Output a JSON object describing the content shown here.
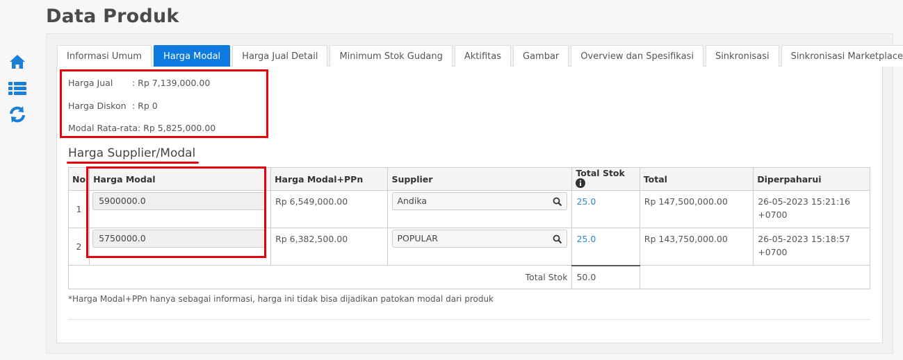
{
  "page": {
    "title": "Data Produk"
  },
  "sidebar": {
    "icons": [
      "home-icon",
      "list-icon",
      "refresh-icon"
    ]
  },
  "tabs": [
    {
      "label": "Informasi Umum"
    },
    {
      "label": "Harga Modal"
    },
    {
      "label": "Harga Jual Detail"
    },
    {
      "label": "Minimum Stok Gudang"
    },
    {
      "label": "Aktifitas"
    },
    {
      "label": "Gambar"
    },
    {
      "label": "Overview dan Spesifikasi"
    },
    {
      "label": "Sinkronisasi"
    },
    {
      "label": "Sinkronisasi Marketplace"
    }
  ],
  "active_tab": "Harga Modal",
  "info": {
    "harga_jual_label": "Harga Jual",
    "harga_jual_value": ": Rp 7,139,000.00",
    "harga_diskon_label": "Harga Diskon",
    "harga_diskon_value": ": Rp 0",
    "modal_label": "Modal Rata-rata:",
    "modal_value": "Rp 5,825,000.00"
  },
  "section_title": "Harga Supplier/Modal",
  "table": {
    "headers": {
      "no": "No",
      "harga_modal": "Harga Modal",
      "harga_ppn": "Harga Modal+PPn",
      "supplier": "Supplier",
      "total_stok": "Total Stok",
      "total": "Total",
      "diperbaharui": "Diperpaharui"
    },
    "rows": [
      {
        "no": "1",
        "harga_modal": "5900000.0",
        "harga_ppn": "Rp 6,549,000.00",
        "supplier": "Andika",
        "stok": "25.0",
        "total": "Rp 147,500,000.00",
        "diperbaharui": "26-05-2023 15:21:16",
        "tz": "+0700"
      },
      {
        "no": "2",
        "harga_modal": "5750000.0",
        "harga_ppn": "Rp 6,382,500.00",
        "supplier": "POPULAR",
        "stok": "25.0",
        "total": "Rp 143,750,000.00",
        "diperbaharui": "26-05-2023 15:18:57",
        "tz": "+0700"
      }
    ],
    "total_stok_label": "Total Stok",
    "total_stok_value": "50.0"
  },
  "note": "*Harga Modal+PPn hanya sebagai informasi, harga ini tidak bisa dijadikan patokan modal dari produk",
  "colors": {
    "accent": "#0d7adf",
    "highlight": "#e8000b",
    "link": "#2a8ad4",
    "sidebar_icon": "#1a7fd6"
  }
}
